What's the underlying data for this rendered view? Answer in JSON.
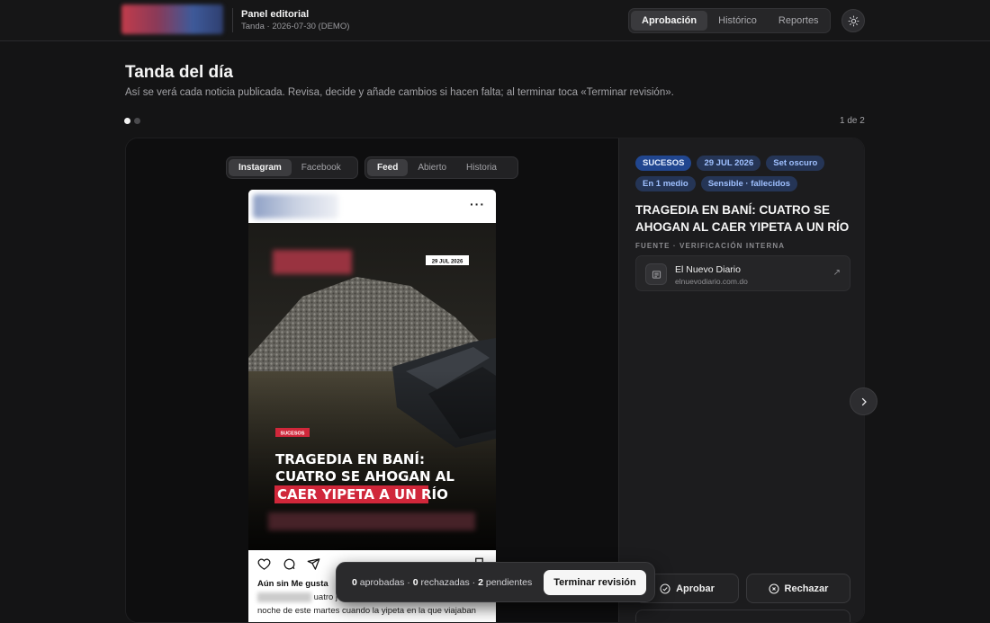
{
  "header": {
    "brand_title": "Panel editorial",
    "brand_subtitle": "Tanda · 2026-07-30 (DEMO)",
    "nav": [
      "Aprobación",
      "Histórico",
      "Reportes"
    ]
  },
  "page": {
    "title": "Tanda del día",
    "subtitle": "Así se verá cada noticia publicada. Revisa, decide y añade cambios si hacen falta; al terminar toca «Terminar revisión».",
    "pager": "1 de 2"
  },
  "preview": {
    "platforms": [
      "Instagram",
      "Facebook"
    ],
    "views": [
      "Feed",
      "Abierto",
      "Historia"
    ],
    "post": {
      "date_stamp": "29 JUL 2026",
      "category": "SUCESOS",
      "headline_l1": "TRAGEDIA EN BANÍ:",
      "headline_l2": "CUATRO SE AHOGAN AL",
      "headline_l3": "CAER YIPETA A UN RÍO",
      "likes": "Aún sin Me gusta",
      "caption_l1": "uatro j",
      "caption_l2": "noche de este martes cuando la yipeta en la que viajaban"
    }
  },
  "details": {
    "tags": [
      "SUCESOS",
      "29 JUL 2026",
      "Set oscuro",
      "En 1 medio",
      "Sensible · fallecidos"
    ],
    "title": "TRAGEDIA EN BANÍ: CUATRO SE AHOGAN AL CAER YIPETA A UN RÍO",
    "source_label": "FUENTE · VERIFICACIÓN INTERNA",
    "source_name": "El Nuevo Diario",
    "source_url": "elnuevodiario.com.do",
    "approve_label": "Aprobar",
    "reject_label": "Rechazar"
  },
  "toast": {
    "approved_count": "0",
    "approved_label": " aprobadas · ",
    "rejected_count": "0",
    "rejected_label": " rechazadas · ",
    "pending_count": "2",
    "pending_label": " pendientes",
    "finish_label": "Terminar revisión"
  },
  "colors": {
    "accent": "#21468f",
    "background": "#141415",
    "panel": "#1c1c1e",
    "headline_highlight": "#d0273a"
  },
  "icons": [
    "sun-icon",
    "more-icon",
    "heart-icon",
    "comment-icon",
    "share-icon",
    "bookmark-icon",
    "document-icon",
    "external-link-icon",
    "check-circle-icon",
    "x-circle-icon",
    "chevron-right-icon"
  ]
}
